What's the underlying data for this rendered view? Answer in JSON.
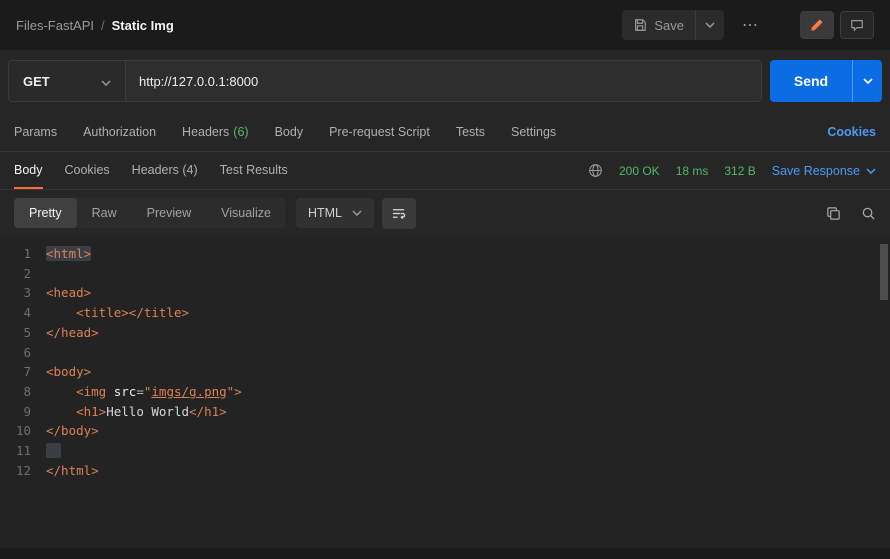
{
  "topbar": {
    "breadcrumb": {
      "workspace": "Files-FastAPI",
      "separator": "/",
      "request_name": "Static Img"
    },
    "save_label": "Save",
    "more_glyph": "⋯"
  },
  "request": {
    "method": "GET",
    "url": "http://127.0.0.1:8000",
    "send_label": "Send"
  },
  "request_tabs": {
    "params": "Params",
    "authorization": "Authorization",
    "headers": "Headers",
    "headers_count": "(6)",
    "body": "Body",
    "pre_request": "Pre-request Script",
    "tests": "Tests",
    "settings": "Settings",
    "cookies_link": "Cookies"
  },
  "response": {
    "tab_body": "Body",
    "tab_cookies": "Cookies",
    "tab_headers": "Headers (4)",
    "tab_tests": "Test Results",
    "status": "200 OK",
    "time": "18 ms",
    "size": "312 B",
    "save_response": "Save Response"
  },
  "viewer": {
    "mode_pretty": "Pretty",
    "mode_raw": "Raw",
    "mode_preview": "Preview",
    "mode_visualize": "Visualize",
    "language": "HTML"
  },
  "colors": {
    "accent_orange": "#ff6c37",
    "status_green": "#53b96a",
    "link_blue": "#4e9af5",
    "send_blue": "#0b6ce3"
  },
  "code": {
    "lines": [
      {
        "n": "1",
        "tokens": [
          [
            "tag sel",
            "<html>"
          ]
        ]
      },
      {
        "n": "2",
        "tokens": []
      },
      {
        "n": "3",
        "tokens": [
          [
            "tag",
            "<head>"
          ]
        ]
      },
      {
        "n": "4",
        "tokens": [
          [
            "plain",
            "    "
          ],
          [
            "tag",
            "<title></title>"
          ]
        ]
      },
      {
        "n": "5",
        "tokens": [
          [
            "tag",
            "</head>"
          ]
        ]
      },
      {
        "n": "6",
        "tokens": []
      },
      {
        "n": "7",
        "tokens": [
          [
            "tag",
            "<body>"
          ]
        ]
      },
      {
        "n": "8",
        "tokens": [
          [
            "plain",
            "    "
          ],
          [
            "tag",
            "<img "
          ],
          [
            "attr",
            "src"
          ],
          [
            "punct",
            "="
          ],
          [
            "tag",
            "\""
          ],
          [
            "link",
            "imgs/g.png"
          ],
          [
            "tag",
            "\">"
          ]
        ]
      },
      {
        "n": "9",
        "tokens": [
          [
            "plain",
            "    "
          ],
          [
            "tag",
            "<h1>"
          ],
          [
            "text",
            "Hello World"
          ],
          [
            "tag",
            "</h1>"
          ]
        ]
      },
      {
        "n": "10",
        "tokens": [
          [
            "tag",
            "</body>"
          ]
        ]
      },
      {
        "n": "11",
        "tokens": [
          [
            "sel",
            "  "
          ]
        ]
      },
      {
        "n": "12",
        "tokens": [
          [
            "tag",
            "</html>"
          ]
        ]
      }
    ]
  }
}
